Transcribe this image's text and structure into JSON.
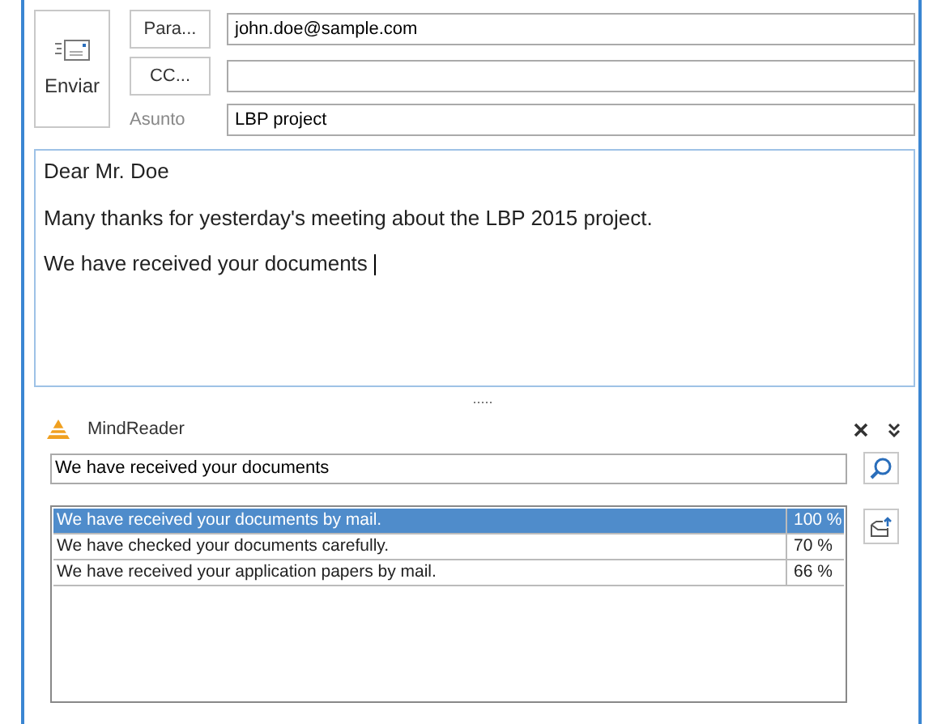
{
  "send_button": {
    "label": "Enviar"
  },
  "to": {
    "button": "Para...",
    "value": "john.doe@sample.com"
  },
  "cc": {
    "button": "CC..."
  },
  "subject": {
    "label": "Asunto",
    "value": "LBP project"
  },
  "body": [
    "Dear Mr. Doe",
    "Many thanks for yesterday's meeting about the LBP 2015 project.",
    "We have received your documents"
  ],
  "splitter": ".....",
  "panel": {
    "title": "MindReader",
    "search": {
      "value": "We have received your documents"
    },
    "results": [
      {
        "text": "We have received your documents by mail.",
        "score": "100 %",
        "selected": true
      },
      {
        "text": "We have checked your documents carefully.",
        "score": "70 %",
        "selected": false
      },
      {
        "text": "We have received your application papers by mail.",
        "score": "66 %",
        "selected": false
      }
    ]
  }
}
